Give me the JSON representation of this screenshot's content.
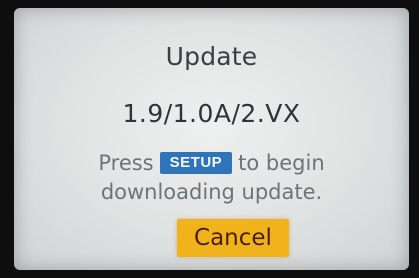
{
  "dialog": {
    "title": "Update",
    "version": "1.9/1.0A/2.VX",
    "instruction_prefix": "Press",
    "key_label": "SETUP",
    "instruction_suffix": "to begin",
    "instruction_line2": "downloading update.",
    "cancel_label": "Cancel"
  },
  "colors": {
    "screen_bg": "#e6e9e8",
    "key_bg": "#2f73b8",
    "cancel_bg": "#f0b31c",
    "cancel_text": "#4a1e0c"
  }
}
